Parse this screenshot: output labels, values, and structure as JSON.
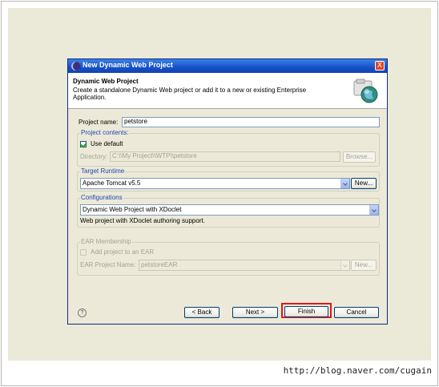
{
  "window": {
    "title": "New Dynamic Web Project",
    "close_glyph": "X"
  },
  "header": {
    "title": "Dynamic Web Project",
    "description": "Create a standalone Dynamic Web project or add it to a new or existing Enterprise Application.",
    "icon": "globe-wizard-icon"
  },
  "project_name": {
    "label": "Project name:",
    "value": "petstore"
  },
  "project_contents": {
    "group_label": "Project contents:",
    "use_default_label": "Use default",
    "use_default_checked": true,
    "directory_label": "Directory:",
    "directory_value": "C:\\\\My Project\\\\WTP\\\\petstore",
    "browse_label": "Browse..."
  },
  "target_runtime": {
    "group_label": "Target Runtime",
    "selected": "Apache Tomcat v5.5",
    "new_label": "New..."
  },
  "configurations": {
    "group_label": "Configurations",
    "selected": "Dynamic Web Project with XDoclet",
    "description": "Web project with XDoclet authoring support."
  },
  "ear_membership": {
    "group_label": "EAR Membership",
    "add_label": "Add project to an EAR",
    "add_checked": false,
    "ear_name_label": "EAR Project Name:",
    "ear_name_value": "petstoreEAR",
    "new_label": "New..."
  },
  "buttons": {
    "back": "< Back",
    "next": "Next >",
    "finish": "Finish",
    "cancel": "Cancel",
    "help_glyph": "?"
  },
  "watermark": {
    "url": "http://blog.naver.com/cugain"
  },
  "colors": {
    "titlebar": "#1650c8",
    "group_label": "#1d48b4",
    "highlight": "#e0161c",
    "background": "#ebe9d8"
  }
}
